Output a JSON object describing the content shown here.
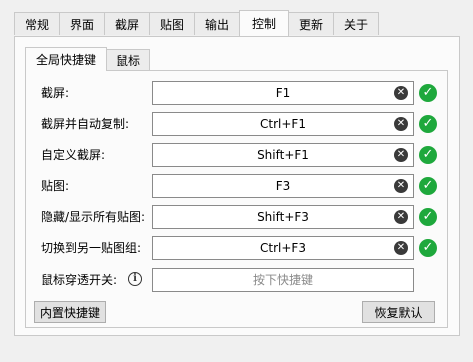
{
  "tabs": [
    {
      "label": "常规",
      "active": false
    },
    {
      "label": "界面",
      "active": false
    },
    {
      "label": "截屏",
      "active": false
    },
    {
      "label": "贴图",
      "active": false
    },
    {
      "label": "输出",
      "active": false
    },
    {
      "label": "控制",
      "active": true
    },
    {
      "label": "更新",
      "active": false
    },
    {
      "label": "关于",
      "active": false
    }
  ],
  "subtabs": [
    {
      "label": "全局快捷键",
      "active": true
    },
    {
      "label": "鼠标",
      "active": false
    }
  ],
  "hotkeys": [
    {
      "label": "截屏:",
      "value": "F1"
    },
    {
      "label": "截屏并自动复制:",
      "value": "Ctrl+F1"
    },
    {
      "label": "自定义截屏:",
      "value": "Shift+F1"
    },
    {
      "label": "贴图:",
      "value": "F3"
    },
    {
      "label": "隐藏/显示所有贴图:",
      "value": "Shift+F3"
    },
    {
      "label": "切换到另一贴图组:",
      "value": "Ctrl+F3"
    }
  ],
  "mouse_passthrough": {
    "label": "鼠标穿透开关:",
    "placeholder": "按下快捷键"
  },
  "icons": {
    "clear": "clear-circle-x-icon",
    "check": "check-circle-icon",
    "info": "info-icon"
  },
  "buttons": {
    "builtin": "内置快捷键",
    "restore": "恢复默认"
  },
  "colors": {
    "check_green": "#1ea83c",
    "panel_bg": "#fbfbfb",
    "window_bg": "#f0f0f0"
  }
}
